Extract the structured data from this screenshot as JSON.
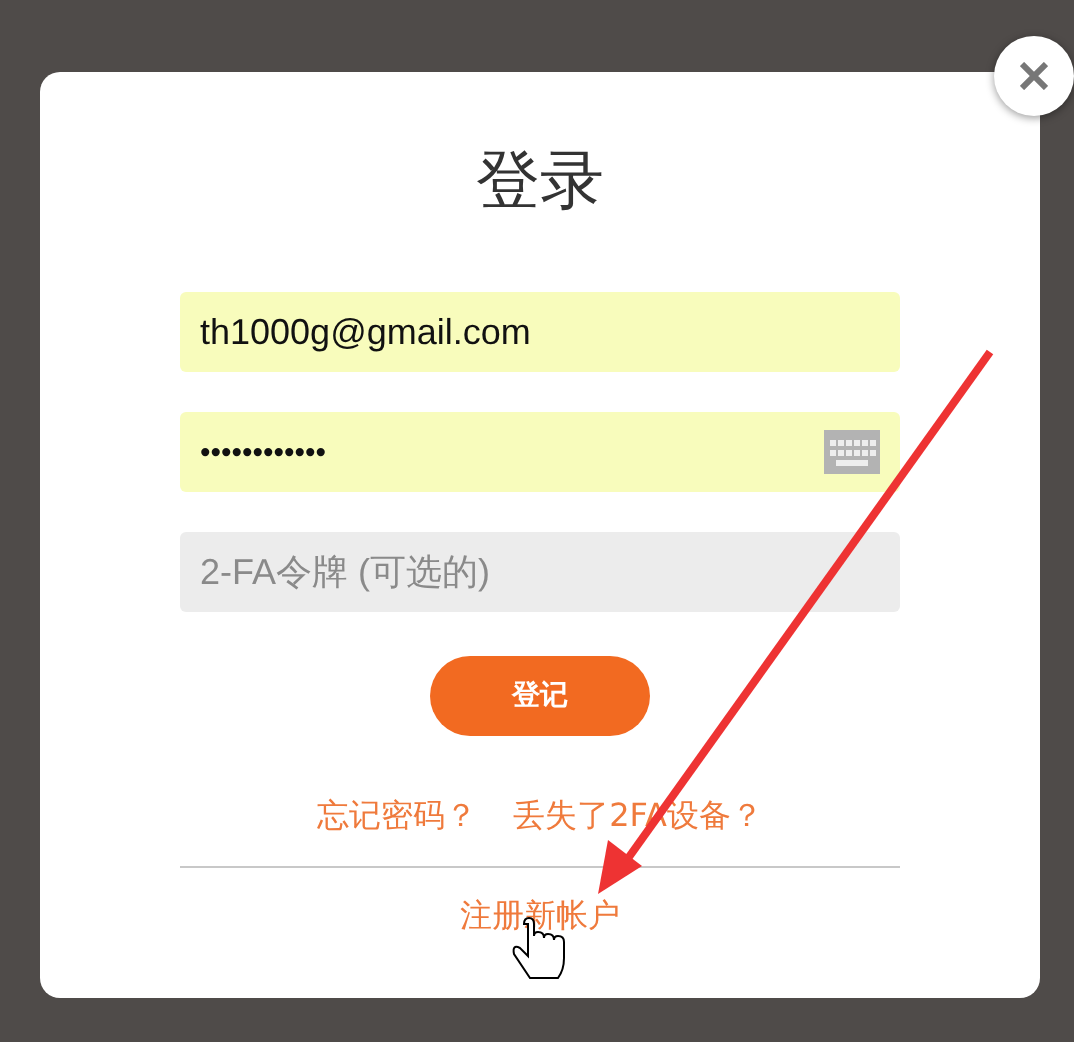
{
  "dialog": {
    "title": "登录",
    "fields": [
      {
        "kind": "text",
        "value": "th1000g@gmail.com",
        "filled": true
      },
      {
        "kind": "password",
        "value": "••••••••••••",
        "filled": true
      },
      {
        "kind": "text",
        "placeholder": "2-FA令牌 (可选的)",
        "filled": false
      }
    ],
    "submit": "登记",
    "links": [
      "忘记密码？",
      "丢失了2FA设备？"
    ],
    "register_link": "注册新帐户"
  }
}
